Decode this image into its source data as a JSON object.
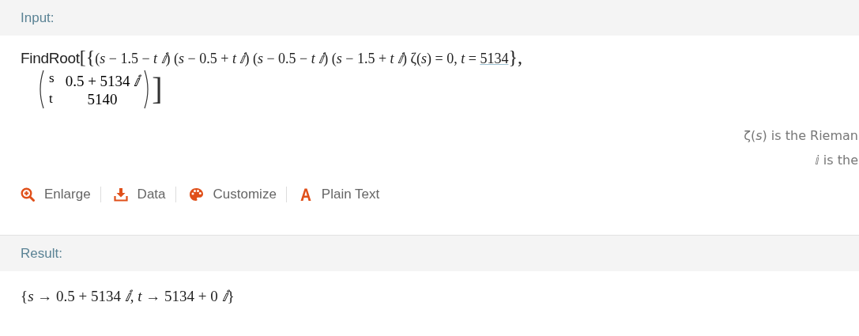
{
  "input": {
    "header": "Input:",
    "head": "FindRoot",
    "open": "[{",
    "expression": "(*s* − 1.5 − *t* *ⅈ*) (*s* − 0.5 + *t* *ⅈ*) (*s* − 0.5 − *t* *ⅈ*) (*s* − 1.5 + *t* *ⅈ*) ζ(*s*) = 0, *t* = ",
    "link": "5134",
    "close_list": "},",
    "matrix": [
      {
        "variable": "s",
        "value": "0.5 + 5134 *ⅈ*"
      },
      {
        "variable": "t",
        "value": "5140"
      }
    ],
    "close": "]",
    "notes": [
      "ζ(*s*) is the Rieman",
      "*ⅈ* is the"
    ]
  },
  "toolbar": [
    {
      "kind": "enlarge",
      "label": "Enlarge"
    },
    {
      "kind": "data",
      "label": "Data"
    },
    {
      "kind": "customize",
      "label": "Customize"
    },
    {
      "kind": "plaintext",
      "label": "Plain Text"
    }
  ],
  "result": {
    "header": "Result:",
    "value": "{*s* → 0.5 + 5134 *ⅈ*, *t* → 5134 + 0 *ⅈ*}"
  }
}
